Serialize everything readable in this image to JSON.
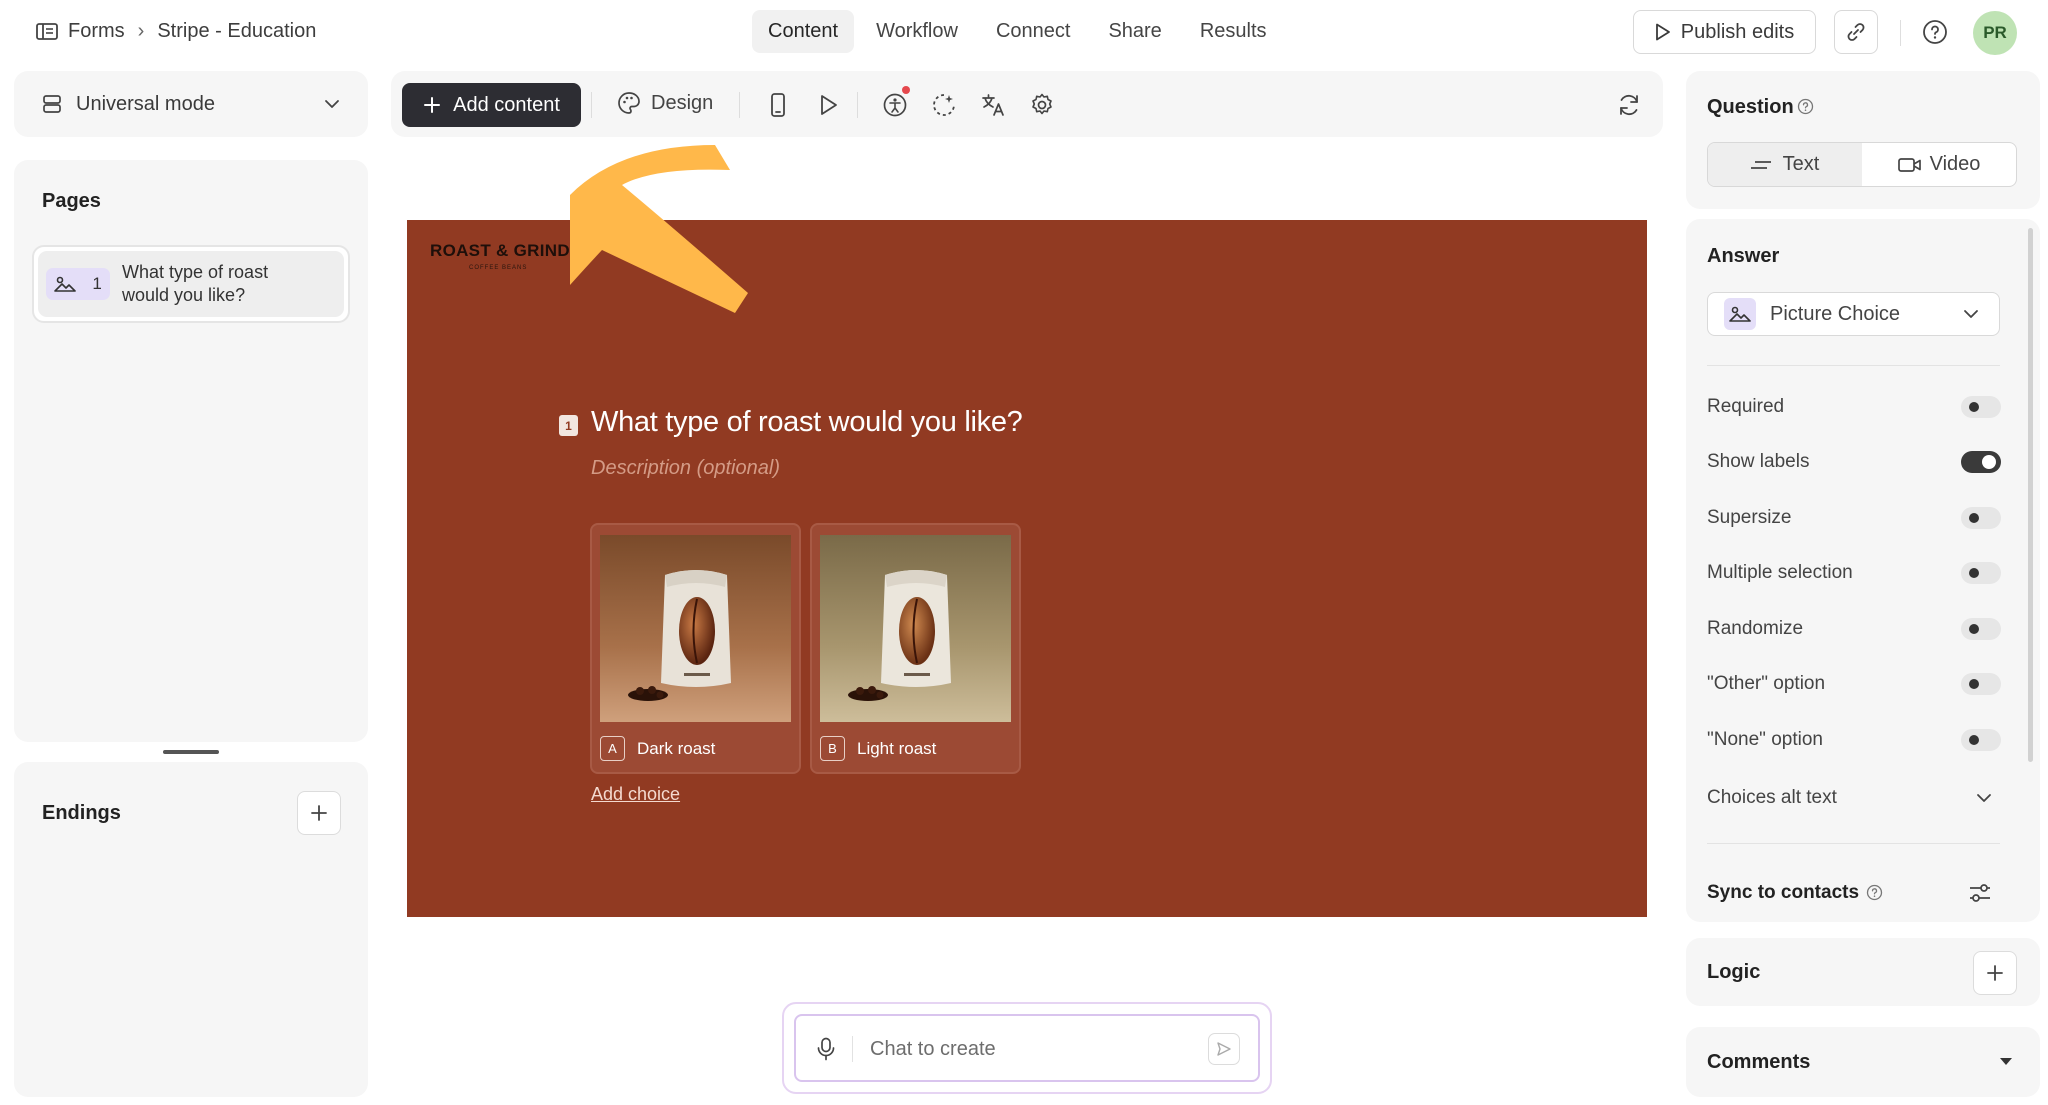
{
  "breadcrumb": {
    "root": "Forms",
    "separator": "›",
    "current": "Stripe - Education"
  },
  "tabs": [
    {
      "label": "Content",
      "active": true
    },
    {
      "label": "Workflow",
      "active": false
    },
    {
      "label": "Connect",
      "active": false
    },
    {
      "label": "Share",
      "active": false
    },
    {
      "label": "Results",
      "active": false
    }
  ],
  "header": {
    "publish_label": "Publish edits",
    "avatar_initials": "PR"
  },
  "left": {
    "mode_label": "Universal mode",
    "pages_title": "Pages",
    "page_item": {
      "number": "1",
      "text": "What type of roast would you like?"
    },
    "endings_title": "Endings"
  },
  "toolbar": {
    "add_content_label": "Add content",
    "design_label": "Design"
  },
  "canvas": {
    "brand": "ROAST & GRIND",
    "brand_sub": "COFFEE BEANS",
    "question_number": "1",
    "question_title": "What type of roast would you like?",
    "description_placeholder": "Description (optional)",
    "background_color": "#913a22",
    "choices": [
      {
        "key": "A",
        "label": "Dark roast"
      },
      {
        "key": "B",
        "label": "Light roast"
      }
    ],
    "add_choice_label": "Add choice"
  },
  "chat": {
    "placeholder": "Chat to create"
  },
  "right": {
    "question_title": "Question",
    "seg_text": "Text",
    "seg_video": "Video",
    "answer_title": "Answer",
    "answer_type": "Picture Choice",
    "settings": [
      {
        "label": "Required",
        "on": false
      },
      {
        "label": "Show labels",
        "on": true
      },
      {
        "label": "Supersize",
        "on": false
      },
      {
        "label": "Multiple selection",
        "on": false
      },
      {
        "label": "Randomize",
        "on": false
      },
      {
        "label": "\"Other\" option",
        "on": false
      },
      {
        "label": "\"None\" option",
        "on": false
      }
    ],
    "choices_alt_text": "Choices alt text",
    "sync_to_contacts": "Sync to contacts",
    "logic_title": "Logic",
    "comments_title": "Comments"
  },
  "colors": {
    "accent_arrow": "#ffb84a",
    "primary_button": "#2d2d33"
  }
}
